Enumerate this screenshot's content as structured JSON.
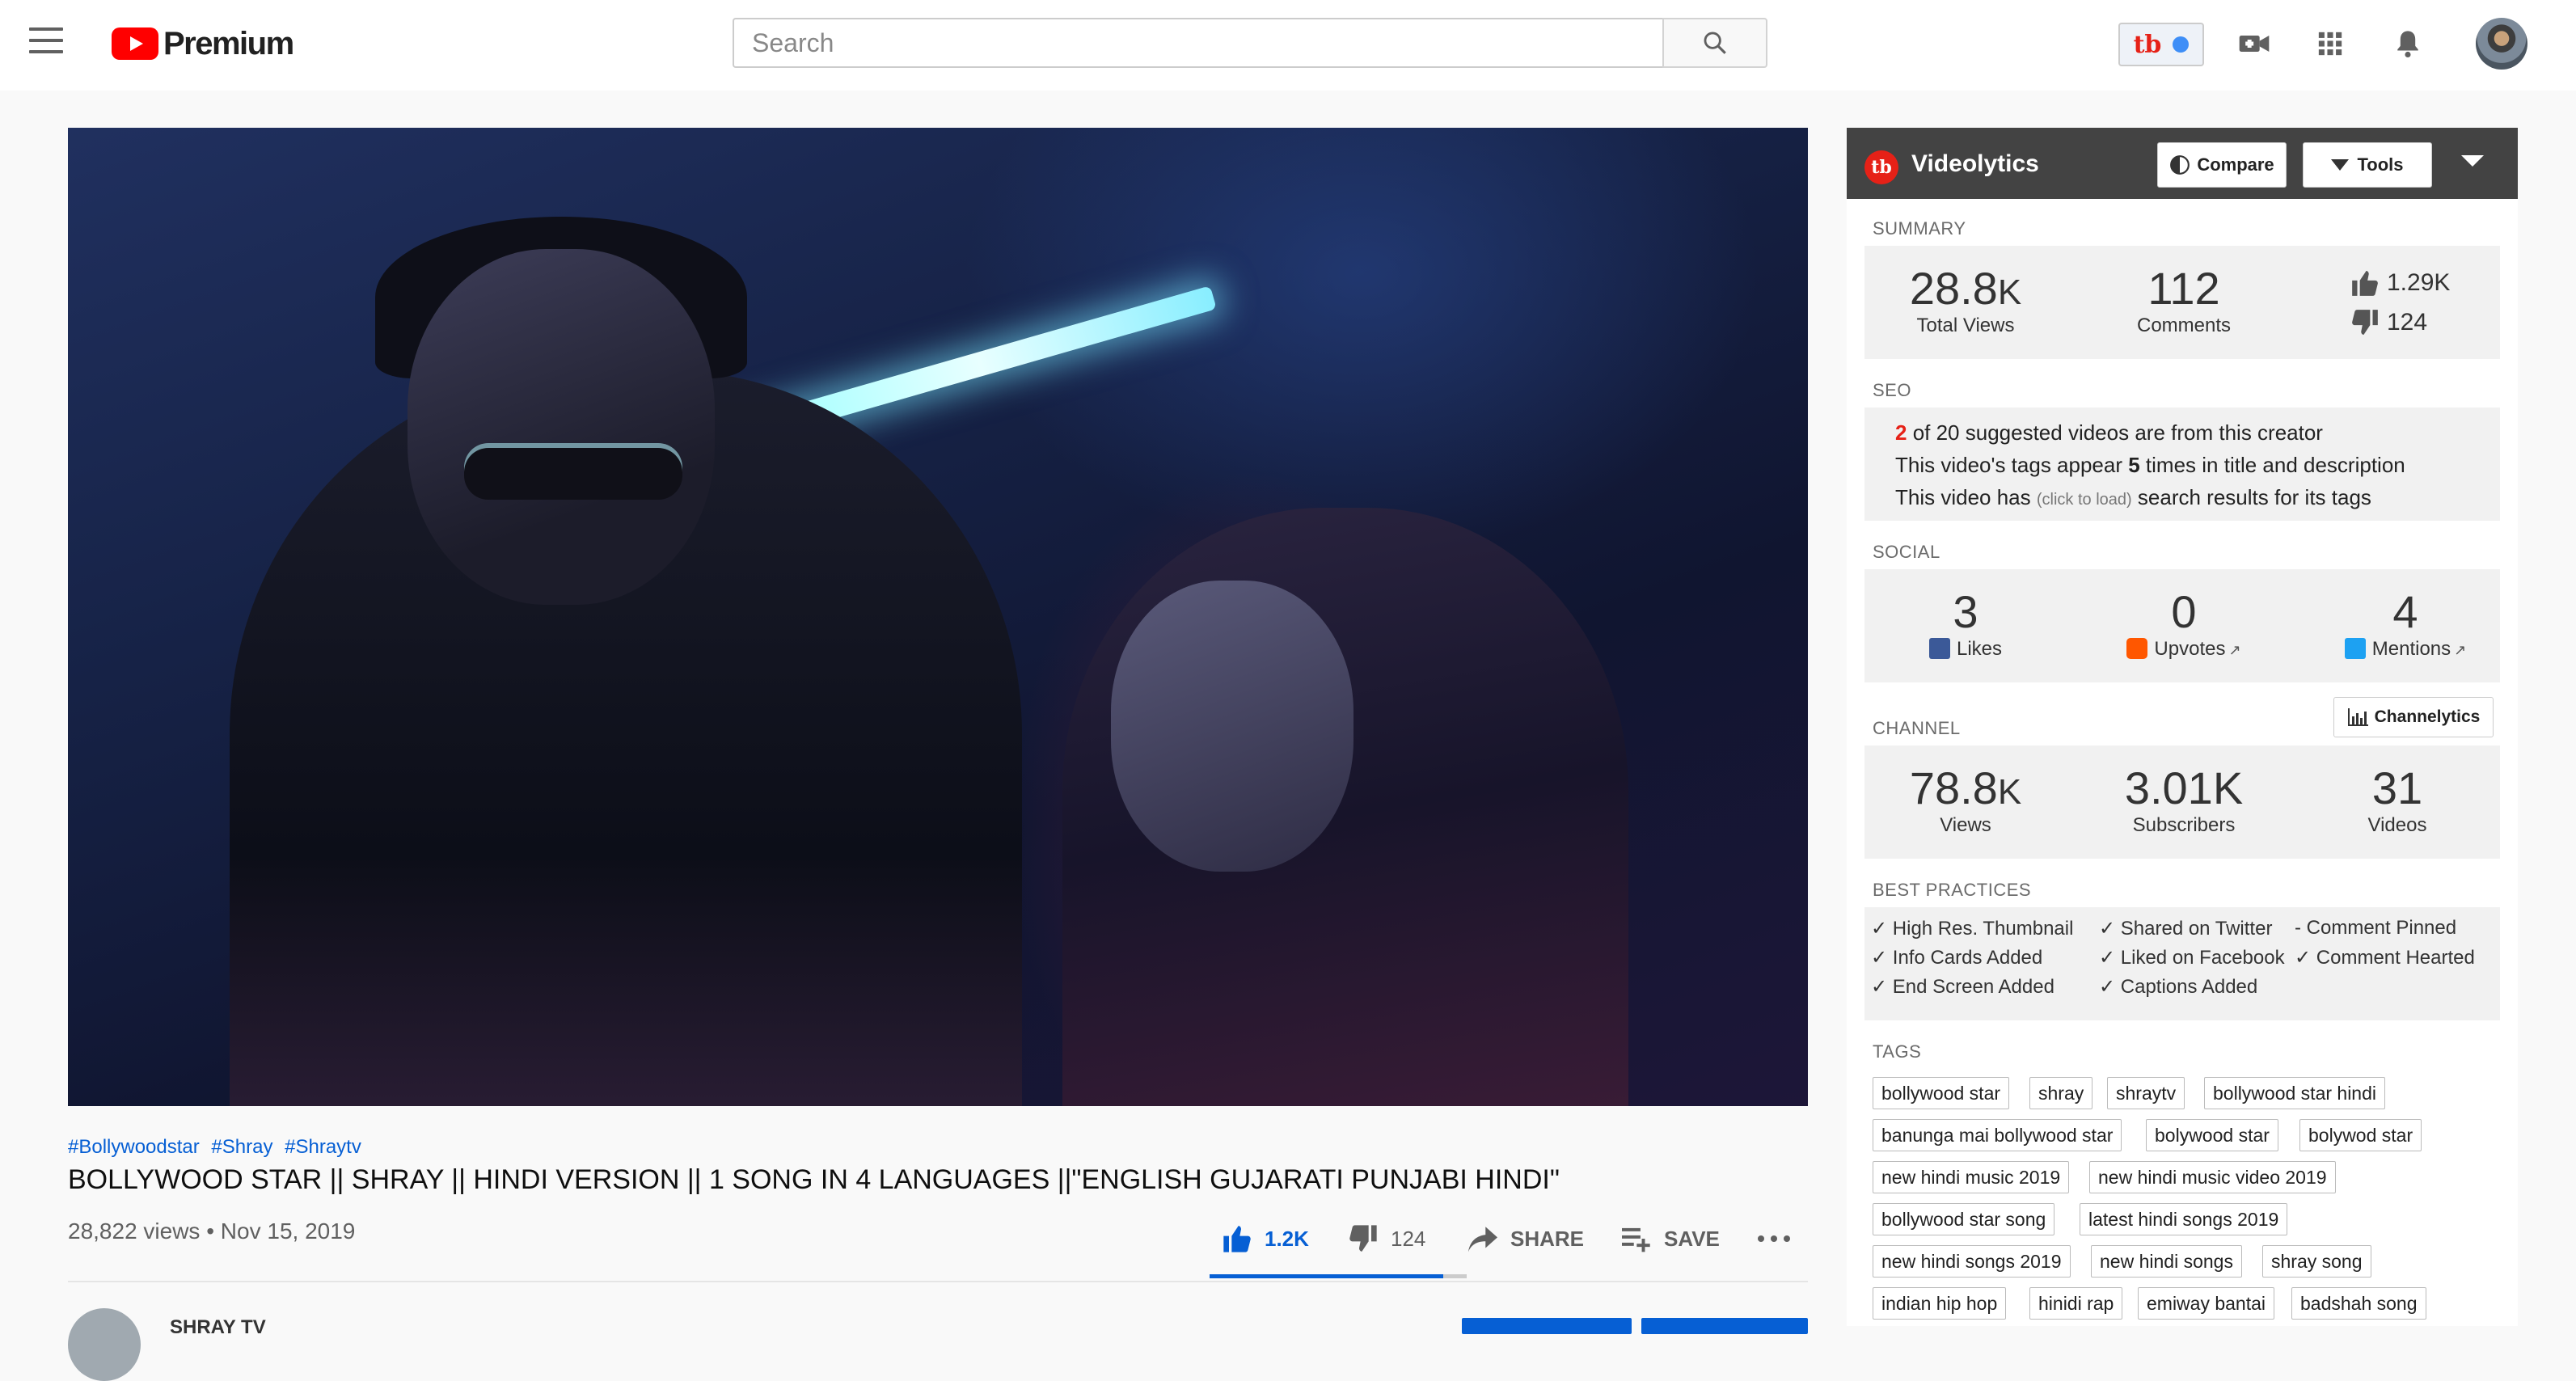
{
  "header": {
    "brand": "Premium",
    "search_placeholder": "Search"
  },
  "video": {
    "hashtags": [
      "#Bollywoodstar",
      "#Shray",
      "#Shraytv"
    ],
    "title": "BOLLYWOOD STAR || SHRAY || HINDI VERSION || 1 SONG IN 4 LANGUAGES ||\"ENGLISH GUJARATI PUNJABI HINDI\"",
    "meta": "28,822 views • Nov 15, 2019",
    "likes": "1.2K",
    "dislikes": "124",
    "share_label": "SHARE",
    "save_label": "SAVE",
    "like_ratio": 0.91,
    "channel_name": "SHRAY TV"
  },
  "videolytics": {
    "title": "Videolytics",
    "compare_label": "Compare",
    "tools_label": "Tools",
    "summary": {
      "label": "SUMMARY",
      "views_num": "28.8",
      "views_unit": "K",
      "views_label": "Total Views",
      "comments": "112",
      "comments_label": "Comments",
      "likes": "1.29K",
      "dislikes": "124"
    },
    "seo": {
      "label": "SEO",
      "line1_num": "2",
      "line1_rest": " of 20 suggested videos are from this creator",
      "line2_pre": "This video's tags appear ",
      "line2_num": "5",
      "line2_post": " times in title and description",
      "line3_pre": "This video has ",
      "line3_link": "(click to load)",
      "line3_post": " search results for its tags"
    },
    "social": {
      "label": "SOCIAL",
      "likes": "3",
      "likes_label": "Likes",
      "upvotes": "0",
      "upvotes_label": "Upvotes",
      "mentions": "4",
      "mentions_label": "Mentions"
    },
    "channel": {
      "label": "CHANNEL",
      "channelytics_label": "Channelytics",
      "views_num": "78.8",
      "views_unit": "K",
      "views_label": "Views",
      "subscribers": "3.01K",
      "subscribers_label": "Subscribers",
      "videos": "31",
      "videos_label": "Videos"
    },
    "best_practices": {
      "label": "BEST PRACTICES",
      "col1": [
        "✓ High Res. Thumbnail",
        "✓ Info Cards Added",
        "✓ End Screen Added"
      ],
      "col2": [
        "✓ Shared on Twitter",
        "✓ Liked on Facebook",
        "✓ Captions Added"
      ],
      "col3": [
        "- Comment Pinned",
        "✓ Comment Hearted"
      ]
    },
    "tags": {
      "label": "TAGS",
      "items": [
        "bollywood star",
        "shray",
        "shraytv",
        "bollywood star hindi",
        "banunga mai bollywood star",
        "bolywood star",
        "bolywod star",
        "new hindi music 2019",
        "new hindi music video 2019",
        "bollywood star song",
        "latest hindi songs 2019",
        "new hindi songs 2019",
        "new hindi songs",
        "shray song",
        "indian hip hop",
        "hinidi rap",
        "emiway bantai",
        "badshah song"
      ]
    }
  },
  "colors": {
    "accent_blue": "#065fd4",
    "brand_red": "#e62117",
    "panel_header": "#434343"
  }
}
